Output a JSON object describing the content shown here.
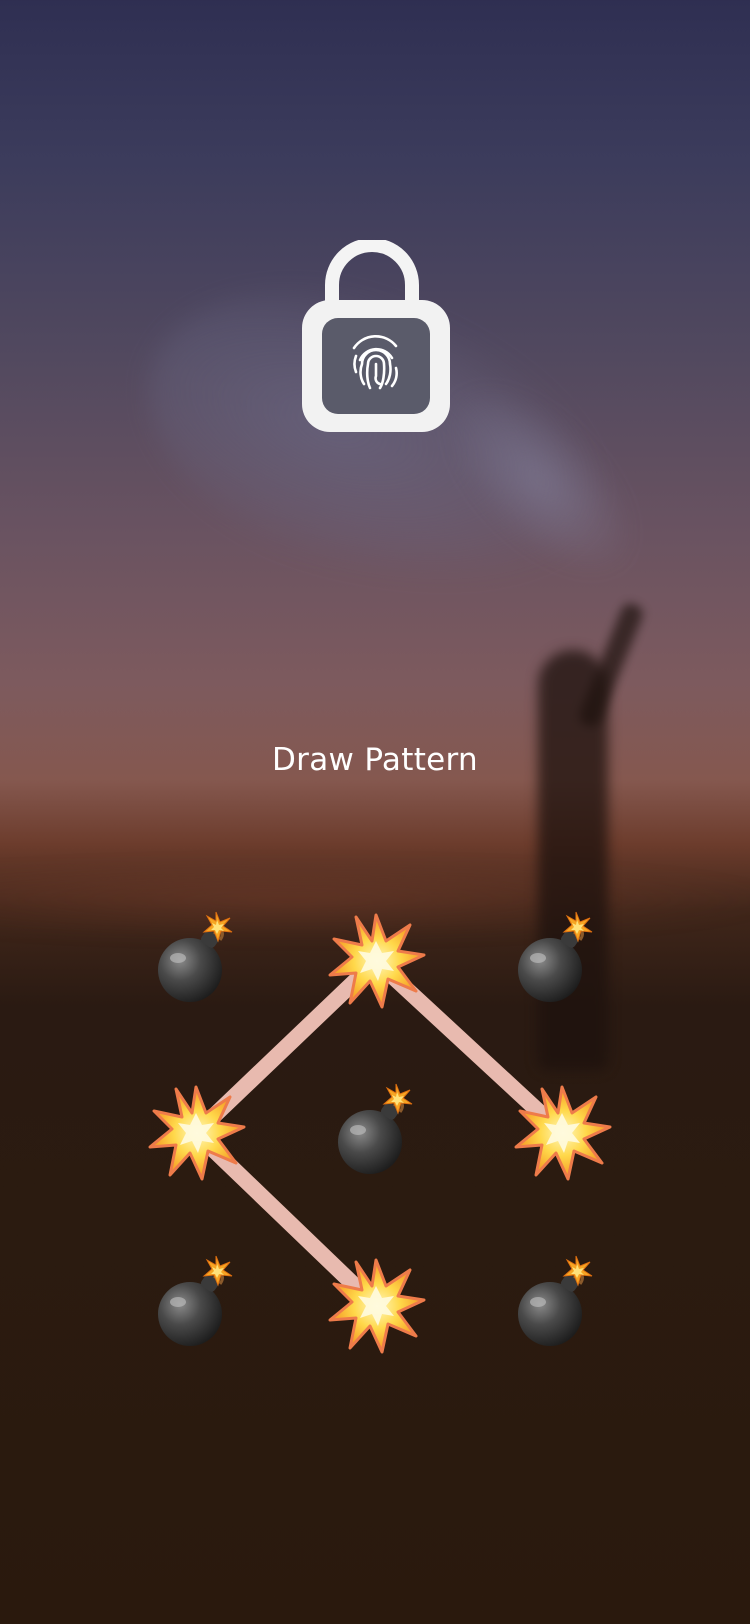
{
  "prompt": {
    "label": "Draw Pattern"
  },
  "lock_icon": {
    "name": "padlock-fingerprint-icon",
    "state": "unlocked"
  },
  "pattern": {
    "grid": "3x3",
    "dots": [
      {
        "id": 1,
        "icon": "bomb-icon"
      },
      {
        "id": 2,
        "icon": "explosion-icon"
      },
      {
        "id": 3,
        "icon": "bomb-icon"
      },
      {
        "id": 4,
        "icon": "explosion-icon"
      },
      {
        "id": 5,
        "icon": "bomb-icon"
      },
      {
        "id": 6,
        "icon": "explosion-icon"
      },
      {
        "id": 7,
        "icon": "bomb-icon"
      },
      {
        "id": 8,
        "icon": "explosion-icon"
      },
      {
        "id": 9,
        "icon": "bomb-icon"
      }
    ],
    "path": [
      6,
      2,
      4,
      8
    ],
    "line_color": "#f3c3b8"
  }
}
